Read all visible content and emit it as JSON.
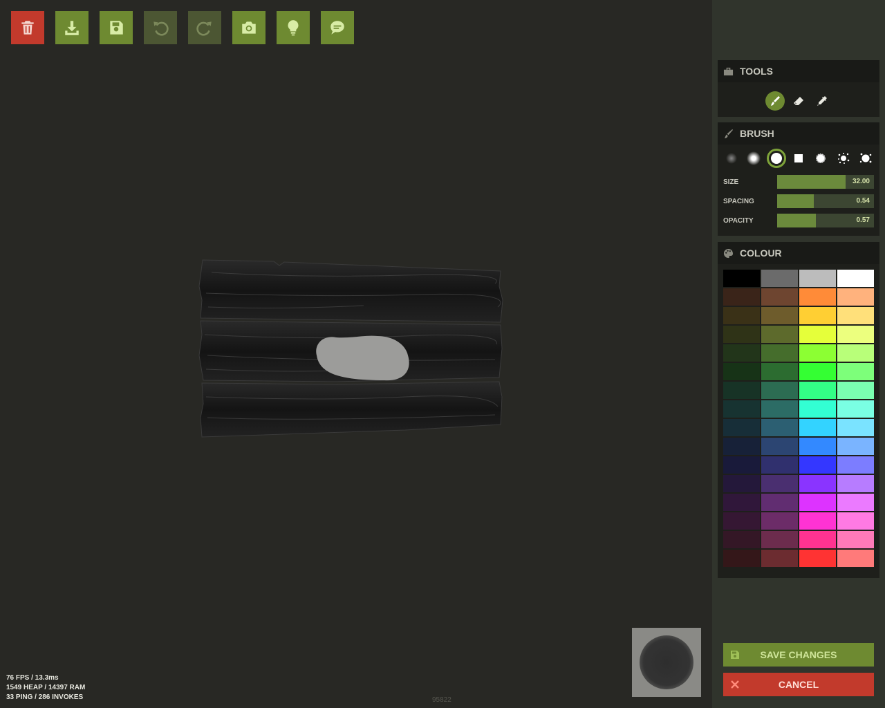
{
  "toolbar": {
    "buttons": [
      {
        "name": "delete-button",
        "icon": "trash-icon",
        "state": "danger"
      },
      {
        "name": "download-button",
        "icon": "download-icon",
        "state": "enabled"
      },
      {
        "name": "save-button",
        "icon": "floppy-icon",
        "state": "enabled"
      },
      {
        "name": "undo-button",
        "icon": "undo-icon",
        "state": "disabled"
      },
      {
        "name": "redo-button",
        "icon": "redo-icon",
        "state": "disabled"
      },
      {
        "name": "screenshot-button",
        "icon": "camera-icon",
        "state": "enabled"
      },
      {
        "name": "hint-button",
        "icon": "lightbulb-icon",
        "state": "enabled"
      },
      {
        "name": "chat-button",
        "icon": "chat-bubble-icon",
        "state": "enabled"
      }
    ]
  },
  "stats": {
    "fps": "76 FPS / 13.3ms",
    "memory": "1549 HEAP / 14397 RAM",
    "network": "33 PING / 286 INVOKES"
  },
  "build": "95822",
  "tools": {
    "title": "TOOLS",
    "items": [
      {
        "name": "paint-brush-tool",
        "icon": "brush-icon",
        "active": true
      },
      {
        "name": "eraser-tool",
        "icon": "eraser-icon",
        "active": false
      },
      {
        "name": "eyedropper-tool",
        "icon": "eyedropper-icon",
        "active": false
      }
    ]
  },
  "brush": {
    "title": "BRUSH",
    "shapes": [
      "soft-dot-icon",
      "soft-circle-icon",
      "hard-circle-icon",
      "square-icon",
      "rough-circle-icon",
      "splatter-icon",
      "splatter-large-icon"
    ],
    "active_shape_index": 2,
    "sliders": [
      {
        "label": "SIZE",
        "value": "32.00",
        "fraction": 0.71
      },
      {
        "label": "SPACING",
        "value": "0.54",
        "fraction": 0.38
      },
      {
        "label": "OPACITY",
        "value": "0.57",
        "fraction": 0.4
      }
    ]
  },
  "colour": {
    "title": "COLOUR",
    "swatches": [
      "#000000",
      "#6b6b6b",
      "#bcbcbc",
      "#ffffff",
      "#3a2419",
      "#6e4530",
      "#ff8b38",
      "#ffb27d",
      "#3a3117",
      "#6e5c2c",
      "#ffcf33",
      "#ffe07a",
      "#2f3317",
      "#5d6a2c",
      "#e5ff3a",
      "#ecff7e",
      "#22351a",
      "#456d2c",
      "#8cff33",
      "#b8ff79",
      "#173317",
      "#2c6c30",
      "#34ff33",
      "#7dff7a",
      "#173326",
      "#2c6c52",
      "#33ff86",
      "#7affb1",
      "#173331",
      "#2c6c65",
      "#33ffd3",
      "#7affe3",
      "#172e38",
      "#2c5f72",
      "#33d3ff",
      "#7ae3ff",
      "#172138",
      "#2c4572",
      "#3389ff",
      "#7ab4ff",
      "#191a3a",
      "#30306e",
      "#3437ff",
      "#7c7dff",
      "#24183a",
      "#4a2f70",
      "#8a34ff",
      "#b77cff",
      "#30173a",
      "#612d71",
      "#dd33ff",
      "#eb7aff",
      "#351733",
      "#6c2c68",
      "#ff33d3",
      "#ff7ae3",
      "#341726",
      "#6c2c4d",
      "#ff3391",
      "#ff7ab9",
      "#341719",
      "#6c2c30",
      "#ff3333",
      "#ff7a7a"
    ]
  },
  "actions": {
    "save_label": "SAVE CHANGES",
    "cancel_label": "CANCEL"
  }
}
